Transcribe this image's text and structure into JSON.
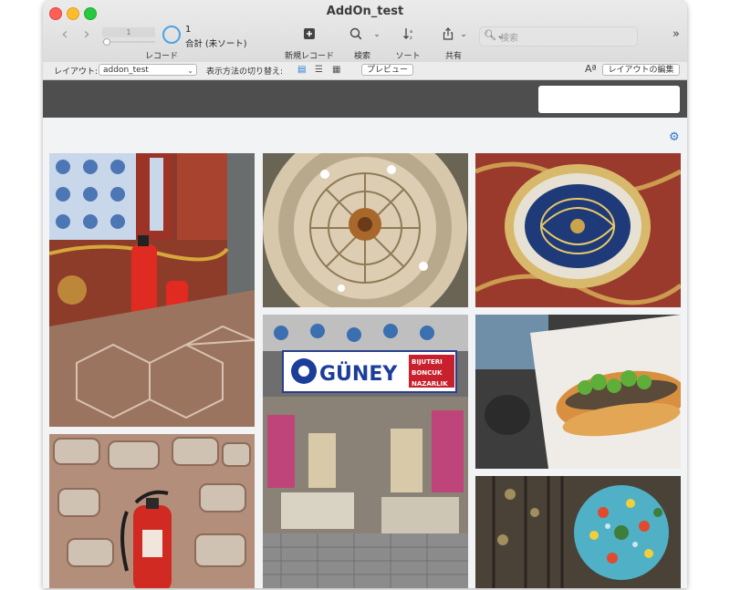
{
  "window": {
    "title": "AddOn_test"
  },
  "toolbar": {
    "record_index": "1",
    "record_count": "1",
    "record_total": "合計 (未ソート)",
    "records_label": "レコード",
    "new_record_label": "新規レコード",
    "find_label": "検索",
    "sort_label": "ソート",
    "share_label": "共有",
    "search_placeholder": "検索"
  },
  "layoutbar": {
    "layout_label": "レイアウト:",
    "layout_value": "addon_test",
    "view_as_label": "表示方法の切り替え:",
    "preview_label": "プレビュー",
    "edit_layout_label": "レイアウトの編集"
  },
  "gallery": {
    "photos": [
      {
        "subject": "fire-extinguisher-tiled-room"
      },
      {
        "subject": "ornate-dome-ceiling"
      },
      {
        "subject": "ornate-ceiling-medallion"
      },
      {
        "subject": "guney-shop-front"
      },
      {
        "subject": "fish-sandwich"
      },
      {
        "subject": "fire-extinguisher-stone-wall"
      },
      {
        "subject": "mosaic-lanterns"
      }
    ]
  },
  "shop_sign": {
    "name": "GÜNEY",
    "line1": "BIJUTERI",
    "line2": "BONCUK",
    "line3": "NAZARLIK"
  },
  "colors": {
    "accent": "#2c76c9",
    "dark_bar": "#4e4e4e"
  }
}
